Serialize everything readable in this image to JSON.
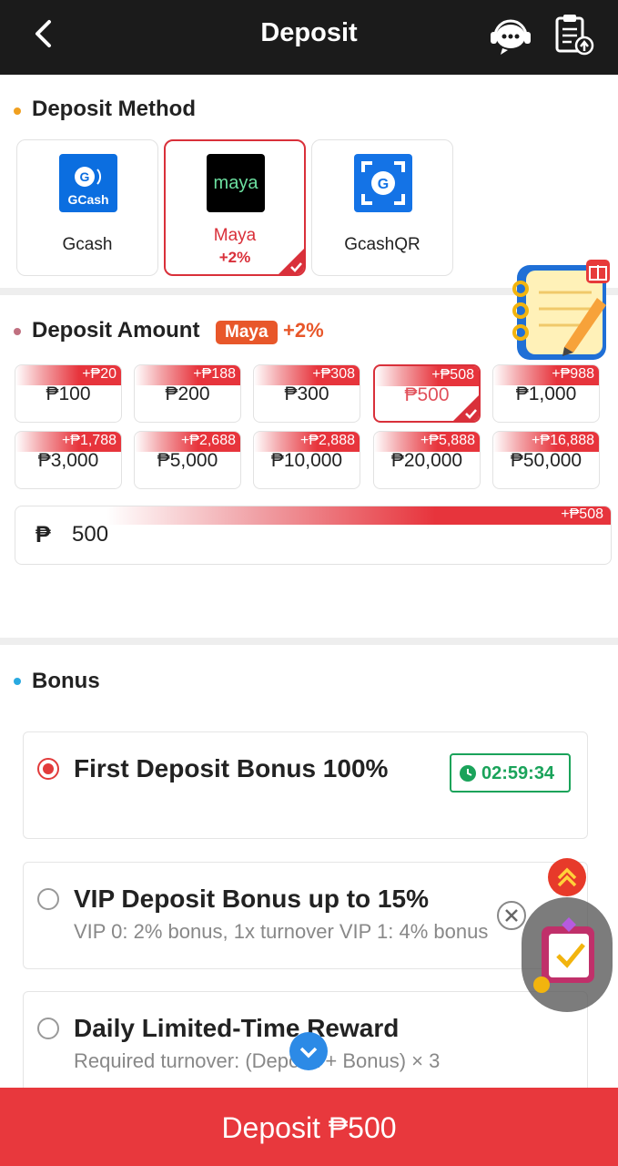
{
  "header": {
    "title": "Deposit",
    "back_icon": "chevron-left-icon",
    "support_icon": "customer-service-icon",
    "records_icon": "clipboard-upload-icon"
  },
  "method_section": {
    "title": "Deposit Method",
    "methods": [
      {
        "label": "Gcash",
        "logo_text": "GCash",
        "selected": false
      },
      {
        "label": "Maya",
        "bonus": "+2%",
        "logo_text": "maya",
        "selected": true
      },
      {
        "label": "GcashQR",
        "logo_text": "G",
        "selected": false
      }
    ]
  },
  "amount_section": {
    "title": "Deposit Amount",
    "badge": "Maya",
    "badge_bonus": "+2%",
    "chips": [
      {
        "amount": "₱100",
        "bonus": "+₱20"
      },
      {
        "amount": "₱200",
        "bonus": "+₱188"
      },
      {
        "amount": "₱300",
        "bonus": "+₱308"
      },
      {
        "amount": "₱500",
        "bonus": "+₱508",
        "selected": true
      },
      {
        "amount": "₱1,000",
        "bonus": "+₱988"
      },
      {
        "amount": "₱3,000",
        "bonus": "+₱1,788"
      },
      {
        "amount": "₱5,000",
        "bonus": "+₱2,688"
      },
      {
        "amount": "₱10,000",
        "bonus": "+₱2,888"
      },
      {
        "amount": "₱20,000",
        "bonus": "+₱5,888"
      },
      {
        "amount": "₱50,000",
        "bonus": "+₱16,888"
      }
    ],
    "input": {
      "currency": "₱",
      "value": "500",
      "bonus": "+₱508"
    }
  },
  "bonus_section": {
    "title": "Bonus",
    "options": [
      {
        "title": "First Deposit Bonus 100%",
        "timer": "02:59:34",
        "selected": true
      },
      {
        "title": "VIP Deposit Bonus up to 15%",
        "sub": "VIP 0: 2% bonus, 1x turnover VIP 1: 4% bonus",
        "selected": false
      },
      {
        "title": "Daily Limited-Time Reward",
        "sub": "Required turnover: (Deposit + Bonus) × 3",
        "selected": false
      }
    ]
  },
  "footer": {
    "button_label": "Deposit ₱500"
  },
  "colors": {
    "accent": "#e8383d",
    "header_bg": "#1b1b1b",
    "timer_green": "#1aa35a",
    "maya_badge": "#e8572a"
  }
}
